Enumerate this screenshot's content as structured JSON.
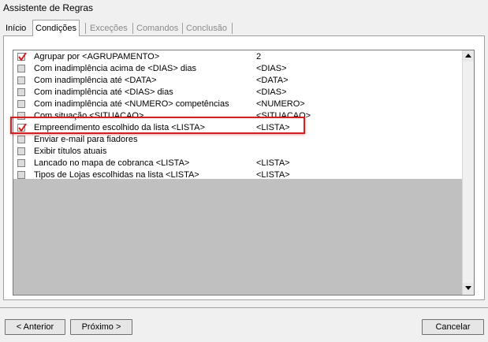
{
  "window": {
    "title": "Assistente de Regras"
  },
  "tabs": [
    {
      "label": "Início",
      "state": "normal"
    },
    {
      "label": "Condições",
      "state": "active"
    },
    {
      "label": "Exceções",
      "state": "disabled"
    },
    {
      "label": "Comandos",
      "state": "disabled"
    },
    {
      "label": "Conclusão",
      "state": "disabled"
    }
  ],
  "conditions": [
    {
      "label": "Agrupar por <AGRUPAMENTO>",
      "value": "2",
      "checked": true
    },
    {
      "label": "Com inadimplência acima de <DIAS> dias",
      "value": "<DIAS>",
      "checked": false
    },
    {
      "label": "Com inadimplência até <DATA>",
      "value": "<DATA>",
      "checked": false
    },
    {
      "label": "Com inadimplência até <DIAS>  dias",
      "value": "<DIAS>",
      "checked": false
    },
    {
      "label": "Com inadimplência até <NUMERO> competências",
      "value": "<NUMERO>",
      "checked": false
    },
    {
      "label": "Com situação <SITUACAO>",
      "value": "<SITUACAO>",
      "checked": false
    },
    {
      "label": "Empreendimento escolhido da lista <LISTA>",
      "value": "<LISTA>",
      "checked": true,
      "highlighted": true
    },
    {
      "label": "Enviar e-mail para fiadores",
      "value": "",
      "checked": false
    },
    {
      "label": "Exibir títulos atuais",
      "value": "",
      "checked": false
    },
    {
      "label": "Lancado no mapa de cobranca <LISTA>",
      "value": "<LISTA>",
      "checked": false
    },
    {
      "label": "Tipos de Lojas escolhidas na lista <LISTA>",
      "value": "<LISTA>",
      "checked": false
    }
  ],
  "buttons": {
    "back": "< Anterior",
    "next": "Próximo >",
    "cancel": "Cancelar"
  },
  "colors": {
    "highlight": "#d02020",
    "check": "#d02020"
  },
  "icons": {
    "scroll_up": "triangle-up-icon",
    "scroll_down": "triangle-down-icon",
    "check": "checkmark-icon"
  }
}
